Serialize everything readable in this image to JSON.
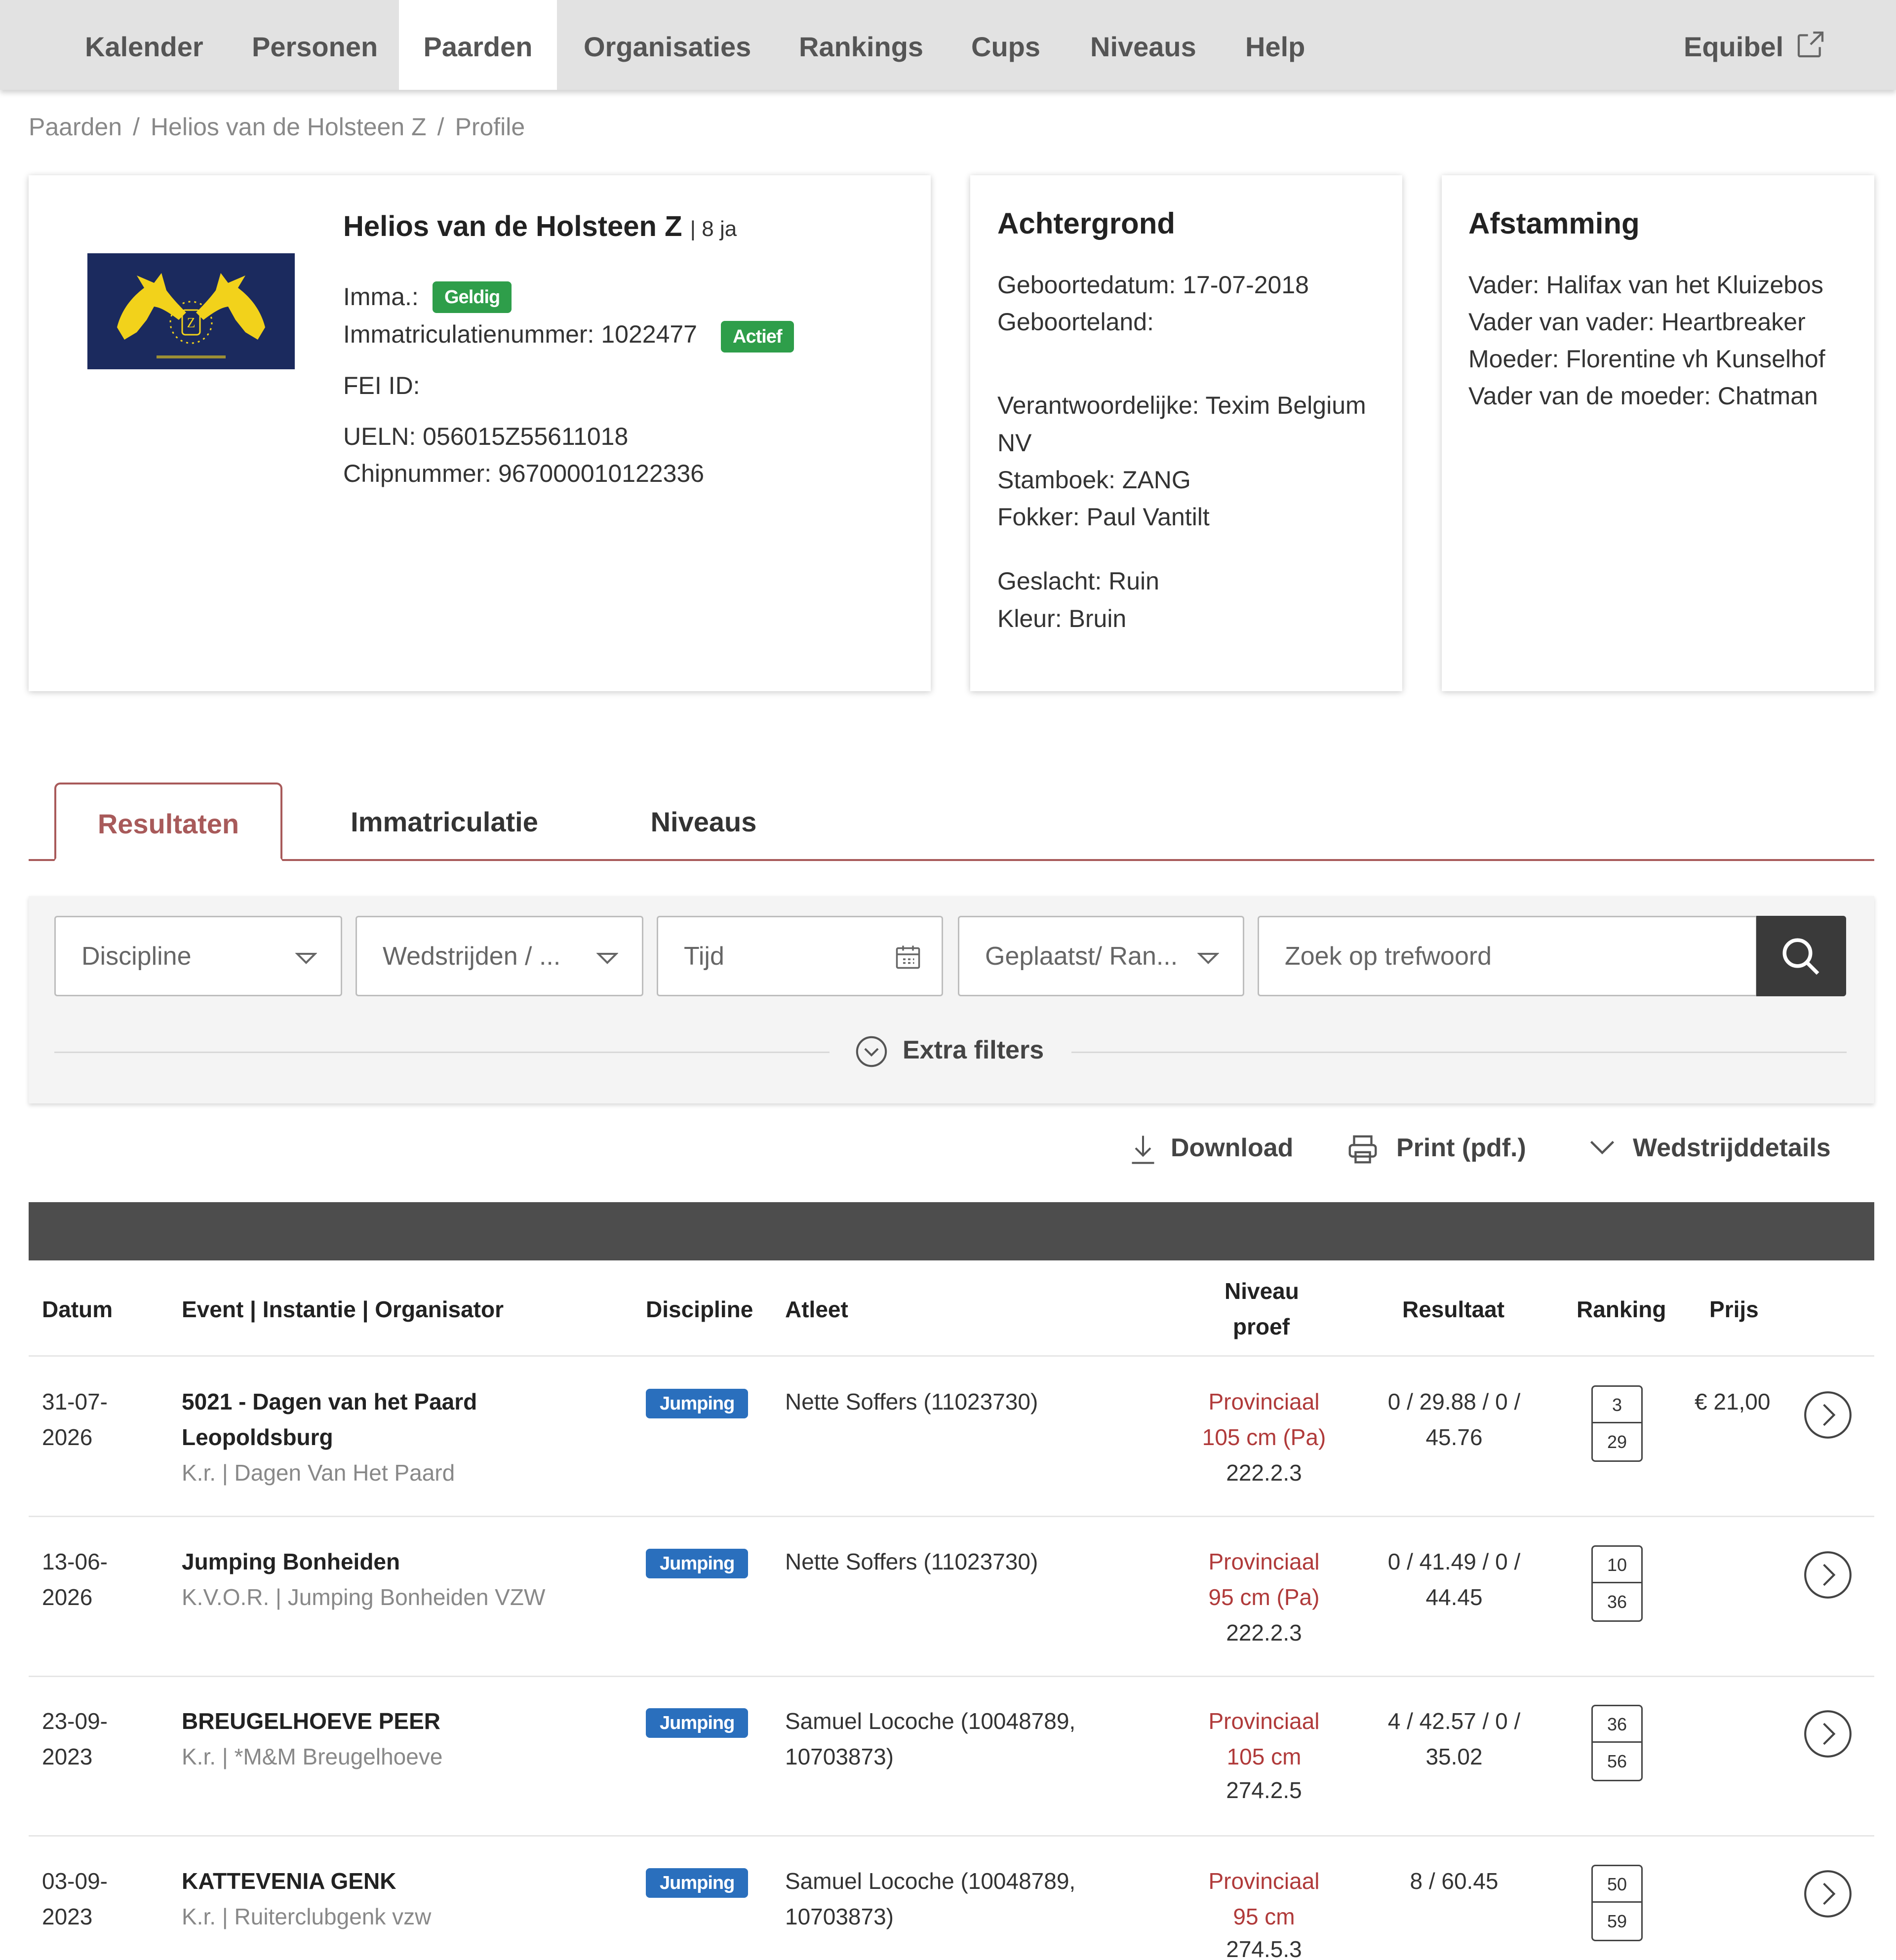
{
  "nav": {
    "items": [
      "Kalender",
      "Personen",
      "Paarden",
      "Organisaties",
      "Rankings",
      "Cups",
      "Niveaus",
      "Help"
    ],
    "active": "Paarden",
    "external": "Equibel"
  },
  "breadcrumb": [
    "Paarden",
    "Helios van de Holsteen Z",
    "Profile"
  ],
  "horse": {
    "name": "Helios van de Holsteen Z",
    "age": "| 8 ja",
    "imma_label": "Imma.:",
    "imma_badge": "Geldig",
    "immat_number": "Immatriculatienummer: 1022477",
    "immat_badge": "Actief",
    "fei_id": "FEI ID:",
    "ueln": "UELN: 056015Z55611018",
    "chip": "Chipnummer: 967000010122336"
  },
  "background": {
    "title": "Achtergrond",
    "birthdate": "Geboortedatum: 17-07-2018",
    "birthcountry": "Geboorteland:",
    "responsible_1": "Verantwoordelijke: Texim Belgium",
    "responsible_2": "NV",
    "studbook": "Stamboek: ZANG",
    "breeder": "Fokker: Paul Vantilt",
    "sex": "Geslacht: Ruin",
    "color": "Kleur: Bruin"
  },
  "pedigree": {
    "title": "Afstamming",
    "sire": "Vader: Halifax van het Kluizebos",
    "sire_sire": "Vader van vader: Heartbreaker",
    "dam": "Moeder: Florentine vh Kunselhof",
    "dam_sire": "Vader van de moeder: Chatman"
  },
  "tabs": [
    "Resultaten",
    "Immatriculatie",
    "Niveaus"
  ],
  "filters": {
    "discipline": "Discipline",
    "competitions": "Wedstrijden / ...",
    "time": "Tijd",
    "placed": "Geplaatst/ Ran...",
    "search_placeholder": "Zoek op trefwoord",
    "extra": "Extra filters"
  },
  "actions": {
    "download": "Download",
    "print": "Print (pdf.)",
    "details": "Wedstrijddetails"
  },
  "table": {
    "headers": {
      "date": "Datum",
      "event": "Event | Instantie | Organisator",
      "discipline": "Discipline",
      "athlete": "Atleet",
      "level_1": "Niveau",
      "level_2": "proef",
      "result": "Resultaat",
      "ranking": "Ranking",
      "prize": "Prijs"
    },
    "rows": [
      {
        "date_1": "31-07-",
        "date_2": "2026",
        "event_1": "5021 - Dagen van het Paard",
        "event_2": "Leopoldsburg",
        "org": "K.r. | Dagen Van Het Paard",
        "discipline": "Jumping",
        "athlete_1": "Nette Soffers (11023730)",
        "athlete_2": "",
        "level_1": "Provinciaal",
        "level_2": "105 cm (Pa)",
        "level_3": "222.2.3",
        "result_1": "0 / 29.88 / 0 /",
        "result_2": "45.76",
        "rank": "3",
        "total": "29",
        "prize": "€ 21,00"
      },
      {
        "date_1": "13-06-",
        "date_2": "2026",
        "event_1": "Jumping Bonheiden",
        "event_2": "",
        "org": "K.V.O.R. | Jumping Bonheiden VZW",
        "discipline": "Jumping",
        "athlete_1": "Nette Soffers (11023730)",
        "athlete_2": "",
        "level_1": "Provinciaal",
        "level_2": "95 cm (Pa)",
        "level_3": "222.2.3",
        "result_1": "0 / 41.49 / 0 /",
        "result_2": "44.45",
        "rank": "10",
        "total": "36",
        "prize": ""
      },
      {
        "date_1": "23-09-",
        "date_2": "2023",
        "event_1": "BREUGELHOEVE PEER",
        "event_2": "",
        "org": "K.r. | *M&M Breugelhoeve",
        "discipline": "Jumping",
        "athlete_1": "Samuel Locoche (10048789,",
        "athlete_2": "10703873)",
        "level_1": "Provinciaal",
        "level_2": "105 cm",
        "level_3": "274.2.5",
        "result_1": "4 / 42.57 / 0 /",
        "result_2": "35.02",
        "rank": "36",
        "total": "56",
        "prize": ""
      },
      {
        "date_1": "03-09-",
        "date_2": "2023",
        "event_1": "KATTEVENIA GENK",
        "event_2": "",
        "org": "K.r. | Ruiterclubgenk vzw",
        "discipline": "Jumping",
        "athlete_1": "Samuel Locoche (10048789,",
        "athlete_2": "10703873)",
        "level_1": "Provinciaal",
        "level_2": "95 cm",
        "level_3": "274.5.3",
        "result_1": "8 / 60.45",
        "result_2": "",
        "rank": "50",
        "total": "59",
        "prize": ""
      }
    ]
  }
}
